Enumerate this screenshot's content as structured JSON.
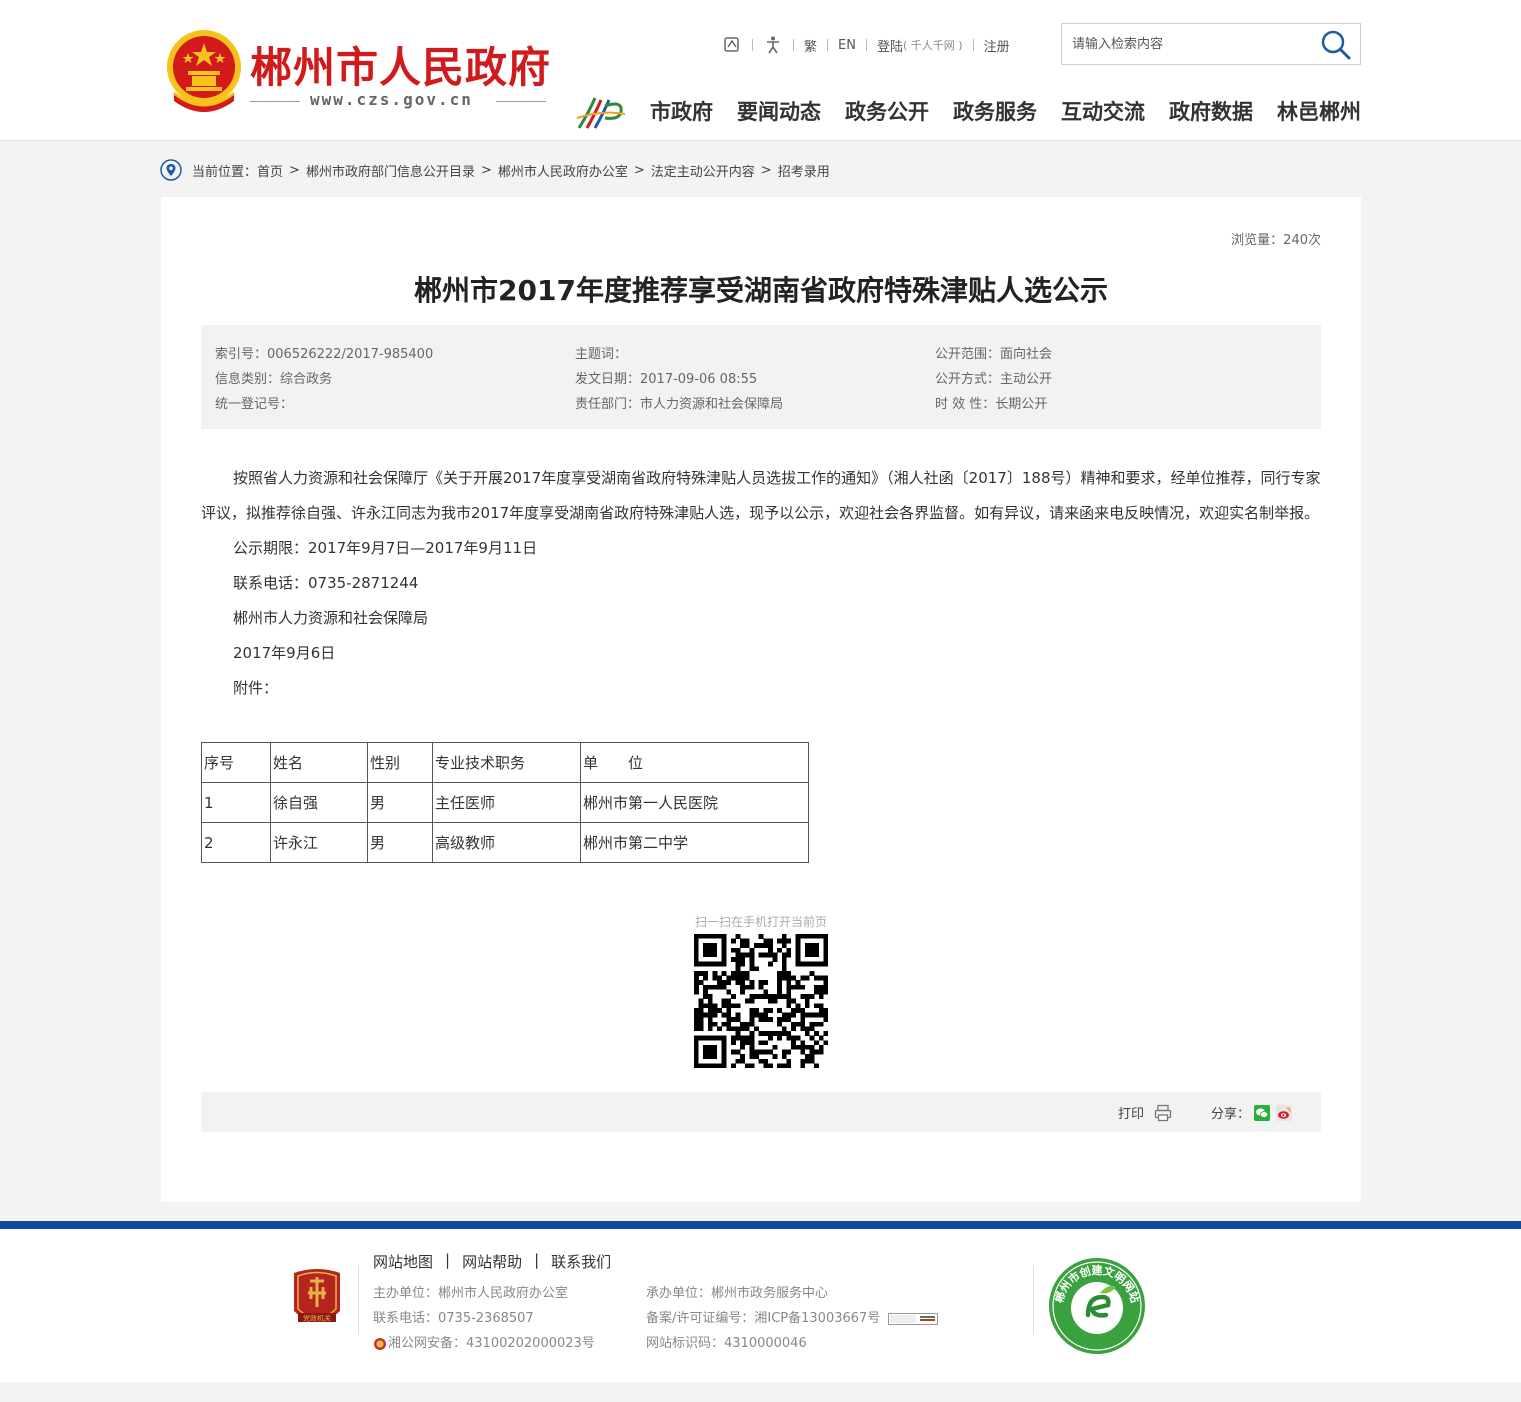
{
  "header": {
    "site_title": "郴州市人民政府",
    "site_url": "www.czs.gov.cn",
    "toplinks": {
      "trad": "繁",
      "en": "EN",
      "login": "登陆",
      "login_sub": "( 千人千网 )",
      "register": "注册"
    },
    "search": {
      "placeholder": "请输入检索内容",
      "value": ""
    },
    "nav": [
      "市政府",
      "要闻动态",
      "政务公开",
      "政务服务",
      "互动交流",
      "政府数据",
      "林邑郴州"
    ]
  },
  "breadcrumb": {
    "prefix": "当前位置：",
    "items": [
      "首页",
      "郴州市政府部门信息公开目录",
      "郴州市人民政府办公室",
      "法定主动公开内容",
      "招考录用"
    ]
  },
  "article": {
    "views": "浏览量：240次",
    "title": "郴州市2017年度推荐享受湖南省政府特殊津贴人选公示",
    "meta": {
      "col1": [
        "索引号：006526222/2017-985400",
        "信息类别：综合政务",
        "统一登记号："
      ],
      "col2": [
        "主题词：",
        "发文日期：2017-09-06 08:55",
        "责任部门：市人力资源和社会保障局"
      ],
      "col3": [
        "公开范围：面向社会",
        "公开方式：主动公开",
        "时 效 性：长期公开"
      ]
    },
    "body": {
      "paragraph": "按照省人力资源和社会保障厅《关于开展2017年度享受湖南省政府特殊津贴人员选拔工作的通知》（湘人社函〔2017〕188号）精神和要求，经单位推荐，同行专家评议，拟推荐徐自强、许永江同志为我市2017年度享受湖南省政府特殊津贴人选，现予以公示，欢迎社会各界监督。如有异议，请来函来电反映情况，欢迎实名制举报。",
      "period": "公示期限：2017年9月7日—2017年9月11日",
      "phone": "联系电话：0735-2871244",
      "org": "郴州市人力资源和社会保障局",
      "date": "2017年9月6日",
      "attachment": "附件："
    },
    "table": {
      "headers": [
        "序号",
        "姓名",
        "性别",
        "专业技术职务",
        "单　　位"
      ],
      "rows": [
        [
          "1",
          "徐自强",
          "男",
          "主任医师",
          "郴州市第一人民医院"
        ],
        [
          "2",
          "许永江",
          "男",
          "高级教师",
          "郴州市第二中学"
        ]
      ]
    },
    "qr_caption": "扫一扫在手机打开当前页",
    "print_label": "打印",
    "share_label": "分享："
  },
  "footer": {
    "links": [
      "网站地图",
      "网站帮助",
      "联系我们"
    ],
    "info_left": [
      "主办单位：郴州市人民政府办公室",
      "联系电话：0735-2368507",
      "湘公网安备：43100202000023号"
    ],
    "info_right": [
      "承办单位：郴州市政务服务中心",
      "备案/许可证编号：湘ICP备13003667号",
      "网站标识码：4310000046"
    ],
    "party_badge_text": "党政机关",
    "civil_badge_text": "郴州市创建文明网站"
  },
  "colors": {
    "title_red": "#d01a1c",
    "footer_blue": "#0d4b9c",
    "search_icon_blue": "#1e5aa8"
  }
}
